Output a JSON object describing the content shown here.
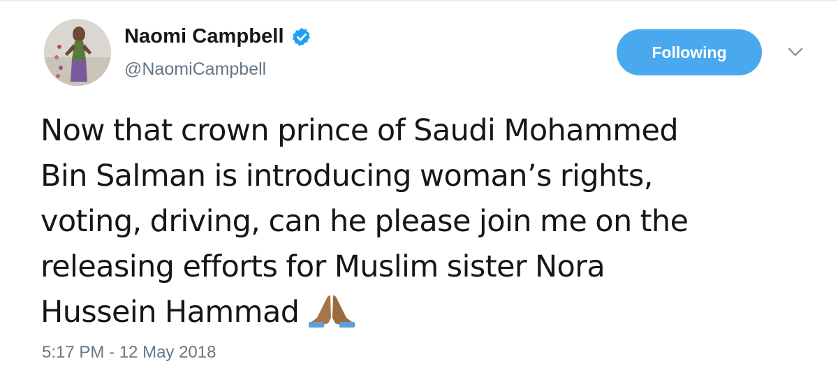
{
  "author": {
    "display_name": "Naomi Campbell",
    "handle": "@NaomiCampbell",
    "verified": true
  },
  "actions": {
    "follow_label": "Following"
  },
  "tweet": {
    "lines": [
      "Now that crown prince of Saudi Mohammed",
      "Bin Salman is introducing woman’s rights,",
      "voting, driving, can he please join me on the",
      "releasing efforts for Muslim sister Nora",
      "Hussein Hammad"
    ],
    "emoji": "folded-hands-emoji",
    "timestamp": "5:17 PM - 12 May 2018"
  },
  "colors": {
    "follow_button": "#4aa8ee",
    "verified_badge": "#1da1f2",
    "secondary_text": "#657786",
    "primary_text": "#14171a"
  },
  "icons": {
    "verified": "verified-badge-icon",
    "caret": "chevron-down-icon"
  }
}
